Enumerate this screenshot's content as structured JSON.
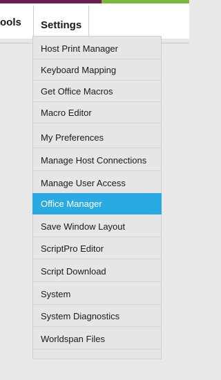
{
  "menubar": {
    "tools_label": "ools",
    "settings_label": "Settings"
  },
  "colors": {
    "accent_purple": "#6b1f4e",
    "accent_green": "#7cb83d",
    "selected": "#2aaae2"
  },
  "dropdown": {
    "items": [
      {
        "label": "Host Print Manager"
      },
      {
        "label": "Keyboard Mapping"
      },
      {
        "label": "Get Office Macros"
      },
      {
        "label": "Macro Editor"
      },
      {
        "label": "My Preferences"
      },
      {
        "label": "Manage Host Connections"
      },
      {
        "label": "Manage User Access"
      },
      {
        "label": "Office Manager",
        "selected": true
      },
      {
        "label": "Save Window Layout"
      },
      {
        "label": "ScriptPro Editor"
      },
      {
        "label": "Script Download"
      },
      {
        "label": "System"
      },
      {
        "label": "System Diagnostics"
      },
      {
        "label": "Worldspan Files"
      }
    ]
  }
}
